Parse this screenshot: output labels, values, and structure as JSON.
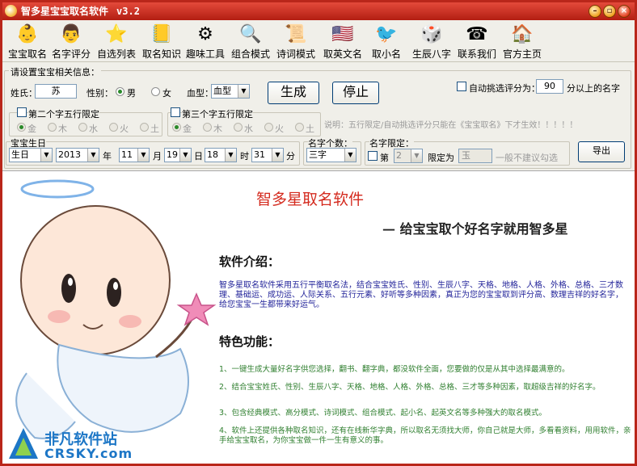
{
  "titlebar": {
    "title": "智多星宝宝取名软件",
    "version": "v3.2",
    "minimize_icon": "minimize-icon",
    "restore_icon": "restore-icon",
    "close_icon": "close-icon"
  },
  "toolbar": [
    {
      "label": "宝宝取名",
      "icon": "baby-icon",
      "glyph": "👶"
    },
    {
      "label": "名字评分",
      "icon": "score-icon",
      "glyph": "👨"
    },
    {
      "label": "自选列表",
      "icon": "star-list-icon",
      "glyph": "⭐"
    },
    {
      "label": "取名知识",
      "icon": "book-icon",
      "glyph": "📒"
    },
    {
      "label": "趣味工具",
      "icon": "gear-icon",
      "glyph": "⚙"
    },
    {
      "label": "组合模式",
      "icon": "magnifier-icon",
      "glyph": "🔍"
    },
    {
      "label": "诗词模式",
      "icon": "poem-icon",
      "glyph": "📜"
    },
    {
      "label": "取英文名",
      "icon": "flag-icon",
      "glyph": "🇺🇸"
    },
    {
      "label": "取小名",
      "icon": "nickname-icon",
      "glyph": "🐦"
    },
    {
      "label": "生辰八字",
      "icon": "bazi-icon",
      "glyph": "🎲"
    },
    {
      "label": "联系我们",
      "icon": "contact-icon",
      "glyph": "☎"
    },
    {
      "label": "官方主页",
      "icon": "home-icon",
      "glyph": "🏠"
    }
  ],
  "form": {
    "group_title": "请设置宝宝相关信息：",
    "surname_label": "姓氏：",
    "surname_value": "苏",
    "gender_label": "性别：",
    "gender_male": "男",
    "gender_female": "女",
    "blood_label": "血型：",
    "blood_value": "血型",
    "generate_button": "生成",
    "stop_button": "停止",
    "auto_pick_label": "自动挑选评分为：",
    "auto_pick_score": "90",
    "auto_pick_suffix": "分以上的名字",
    "second_char_label": "第二个字五行限定",
    "third_char_label": "第三个字五行限定",
    "elements": [
      "金",
      "木",
      "水",
      "火",
      "土"
    ],
    "note": "说明：五行限定/自动挑选评分只能在《宝宝取名》下才生效！！！！！",
    "birthday_group": "宝宝生日",
    "calendar_type": "生日",
    "year": "2013",
    "year_unit": "年",
    "month": "11",
    "month_unit": "月",
    "day": "19",
    "day_unit": "日",
    "hour": "18",
    "hour_unit": "时",
    "minute": "31",
    "minute_unit": "分",
    "name_length_group": "名字个数：",
    "name_length_value": "三字",
    "name_limit_group": "名字限定：",
    "limit_position_prefix": "第",
    "limit_position_value": "2",
    "limit_as_label": "限定为",
    "limit_char_value": "玉",
    "limit_hint": "一般不建议勾选",
    "export_button": "导出"
  },
  "content": {
    "title": "智多星取名软件",
    "subtitle": "— 给宝宝取个好名字就用智多星",
    "intro_heading": "软件介绍：",
    "intro_text": "智多星取名软件采用五行平衡取名法，结合宝宝姓氏、性别、生辰八字、天格、地格、人格、外格、总格、三才数理、基础运、成功运、人际关系、五行元素、好听等多种因素，真正为您的宝宝取到评分高、数理吉祥的好名字，给您宝宝一生都带来好运气。",
    "features_heading": "特色功能：",
    "features": [
      "1、一键生成大量好名字供您选择，翻书、翻字典，都没软件全面，您要做的仅是从其中选择最满意的。",
      "2、结合宝宝姓氏、性别、生辰八字、天格、地格、人格、外格、总格、三才等多种因素，取超级吉祥的好名字。",
      "3、包含经典模式、高分模式、诗词模式、组合模式、起小名、起英文名等多种强大的取名模式。",
      "4、软件上还提供各种取名知识，还有在线新华字典，所以取名无须找大师，你自己就是大师，多看看资料，用用软件，亲手给宝宝取名，为你宝宝做一件一生有意义的事。"
    ],
    "watermark_cn": "非凡软件站",
    "watermark_en": "CRSKY.com"
  }
}
